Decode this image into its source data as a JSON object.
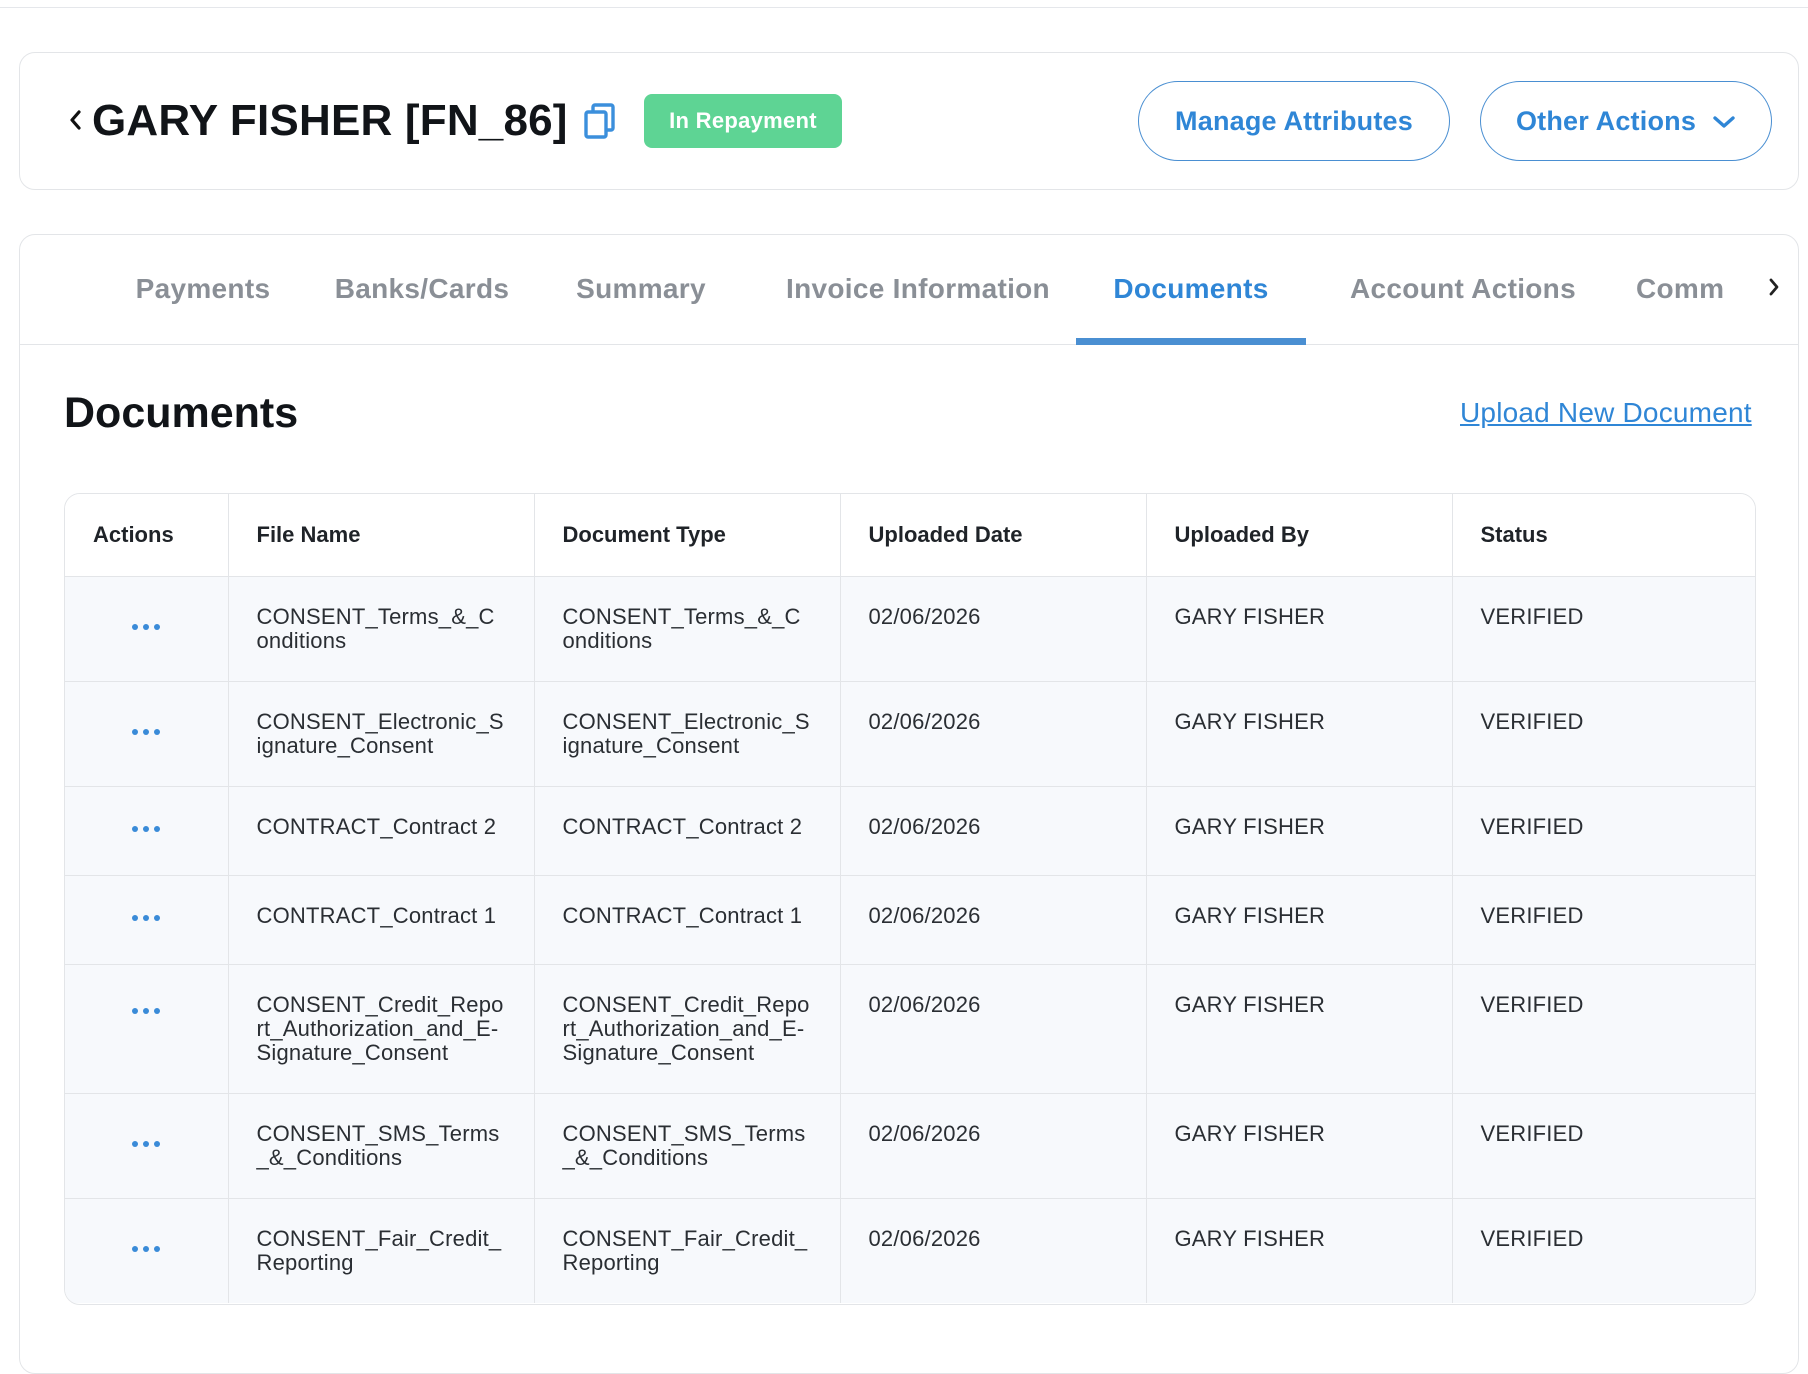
{
  "header": {
    "title": "GARY FISHER [FN_86]",
    "status_badge": "In Repayment",
    "manage_attributes_label": "Manage Attributes",
    "other_actions_label": "Other Actions",
    "icons": {
      "back": "chevron-left-icon",
      "copy": "copy-icon",
      "dropdown": "chevron-down-icon"
    }
  },
  "tabs": [
    {
      "label": "Payments",
      "active": false
    },
    {
      "label": "Banks/Cards",
      "active": false
    },
    {
      "label": "Summary",
      "active": false
    },
    {
      "label": "Invoice Information",
      "active": false
    },
    {
      "label": "Documents",
      "active": true
    },
    {
      "label": "Account Actions",
      "active": false
    },
    {
      "label": "Comm",
      "active": false
    }
  ],
  "documents": {
    "title": "Documents",
    "upload_label": "Upload New Document",
    "columns": [
      "Actions",
      "File Name",
      "Document Type",
      "Uploaded Date",
      "Uploaded By",
      "Status"
    ],
    "rows": [
      {
        "file_name": "CONSENT_Terms_&_Conditions",
        "document_type": "CONSENT_Terms_&_Conditions",
        "uploaded_date": "02/06/2026",
        "uploaded_by": "GARY FISHER",
        "status": "VERIFIED"
      },
      {
        "file_name": "CONSENT_Electronic_Signature_Consent",
        "document_type": "CONSENT_Electronic_Signature_Consent",
        "uploaded_date": "02/06/2026",
        "uploaded_by": "GARY FISHER",
        "status": "VERIFIED"
      },
      {
        "file_name": "CONTRACT_Contract 2",
        "document_type": "CONTRACT_Contract 2",
        "uploaded_date": "02/06/2026",
        "uploaded_by": "GARY FISHER",
        "status": "VERIFIED"
      },
      {
        "file_name": "CONTRACT_Contract 1",
        "document_type": "CONTRACT_Contract 1",
        "uploaded_date": "02/06/2026",
        "uploaded_by": "GARY FISHER",
        "status": "VERIFIED"
      },
      {
        "file_name": "CONSENT_Credit_Report_Authorization_and_E-Signature_Consent",
        "document_type": "CONSENT_Credit_Report_Authorization_and_E-Signature_Consent",
        "uploaded_date": "02/06/2026",
        "uploaded_by": "GARY FISHER",
        "status": "VERIFIED"
      },
      {
        "file_name": "CONSENT_SMS_Terms_&_Conditions",
        "document_type": "CONSENT_SMS_Terms_&_Conditions",
        "uploaded_date": "02/06/2026",
        "uploaded_by": "GARY FISHER",
        "status": "VERIFIED"
      },
      {
        "file_name": "CONSENT_Fair_Credit_Reporting",
        "document_type": "CONSENT_Fair_Credit_Reporting",
        "uploaded_date": "02/06/2026",
        "uploaded_by": "GARY FISHER",
        "status": "VERIFIED"
      }
    ]
  },
  "colors": {
    "accent": "#2f86d6",
    "badge_green": "#5ed494",
    "row_bg": "#f7f9fc"
  }
}
